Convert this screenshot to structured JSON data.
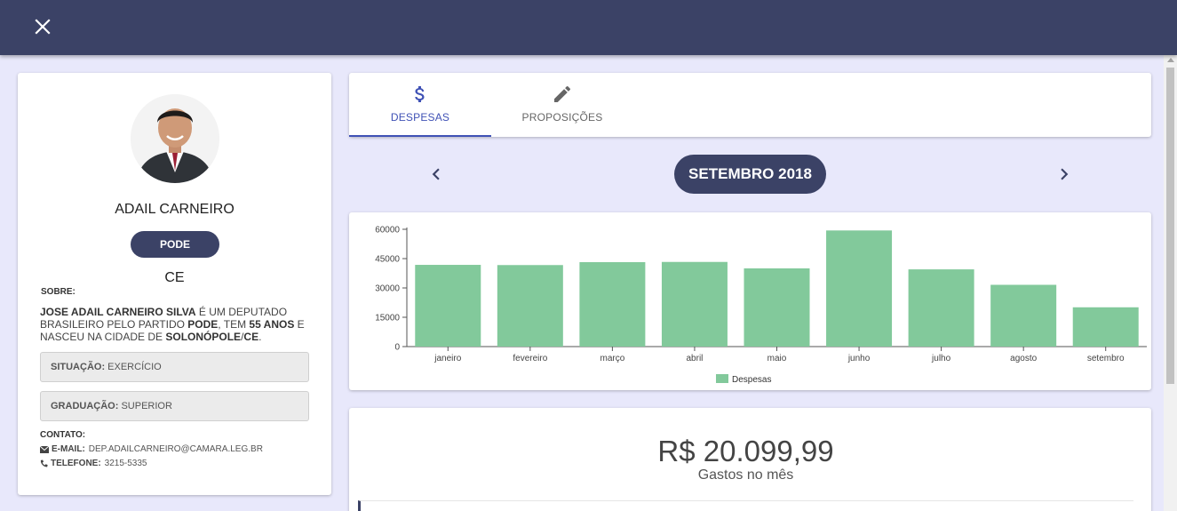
{
  "toolbar": {
    "close_icon": "close-icon"
  },
  "profile": {
    "name": "ADAIL CARNEIRO",
    "party": "PODE",
    "state": "CE",
    "about_label": "SOBRE:",
    "about": {
      "full_name": "JOSE ADAIL CARNEIRO SILVA",
      "t1": " É UM DEPUTADO BRASILEIRO PELO PARTIDO ",
      "party": "PODE",
      "t2": ", TEM ",
      "age": "55 ANOS",
      "t3": " E NASCEU NA CIDADE DE ",
      "city": "SOLONÓPOLE",
      "sep": "/",
      "uf": "CE",
      "end": "."
    },
    "situation_label": "SITUAÇÃO:",
    "situation_value": "EXERCÍCIO",
    "education_label": "GRADUAÇÃO:",
    "education_value": "SUPERIOR",
    "contact_label": "CONTATO:",
    "email_label": "E-MAIL:",
    "email_value": "DEP.ADAILCARNEIRO@CAMARA.LEG.BR",
    "phone_label": "TELEFONE:",
    "phone_value": "3215-5335"
  },
  "tabs": [
    {
      "label": "DESPESAS",
      "icon": "dollar-icon",
      "active": true
    },
    {
      "label": "PROPOSIÇÕES",
      "icon": "pencil-icon",
      "active": false
    }
  ],
  "month_nav": {
    "label": "SETEMBRO 2018",
    "prev_icon": "chevron-left-icon",
    "next_icon": "chevron-right-icon"
  },
  "chart_data": {
    "type": "bar",
    "categories": [
      "janeiro",
      "fevereiro",
      "março",
      "abril",
      "maio",
      "junho",
      "julho",
      "agosto",
      "setembro"
    ],
    "series": [
      {
        "name": "Despesas",
        "values": [
          41800,
          41700,
          43200,
          43300,
          40000,
          59400,
          39500,
          31600,
          20100
        ]
      }
    ],
    "yticks": [
      0,
      15000,
      30000,
      45000,
      60000
    ],
    "ylim": [
      0,
      60000
    ],
    "title": "",
    "xlabel": "",
    "ylabel": "",
    "legend_position": "bottom",
    "bar_color": "#82c99b"
  },
  "summary": {
    "total": "R$ 20.099,99",
    "label": "Gastos no mês"
  },
  "colors": {
    "header": "#3b4266",
    "background": "#e8e8fb",
    "active_tab": "#3f51b5",
    "bar": "#82c99b"
  }
}
